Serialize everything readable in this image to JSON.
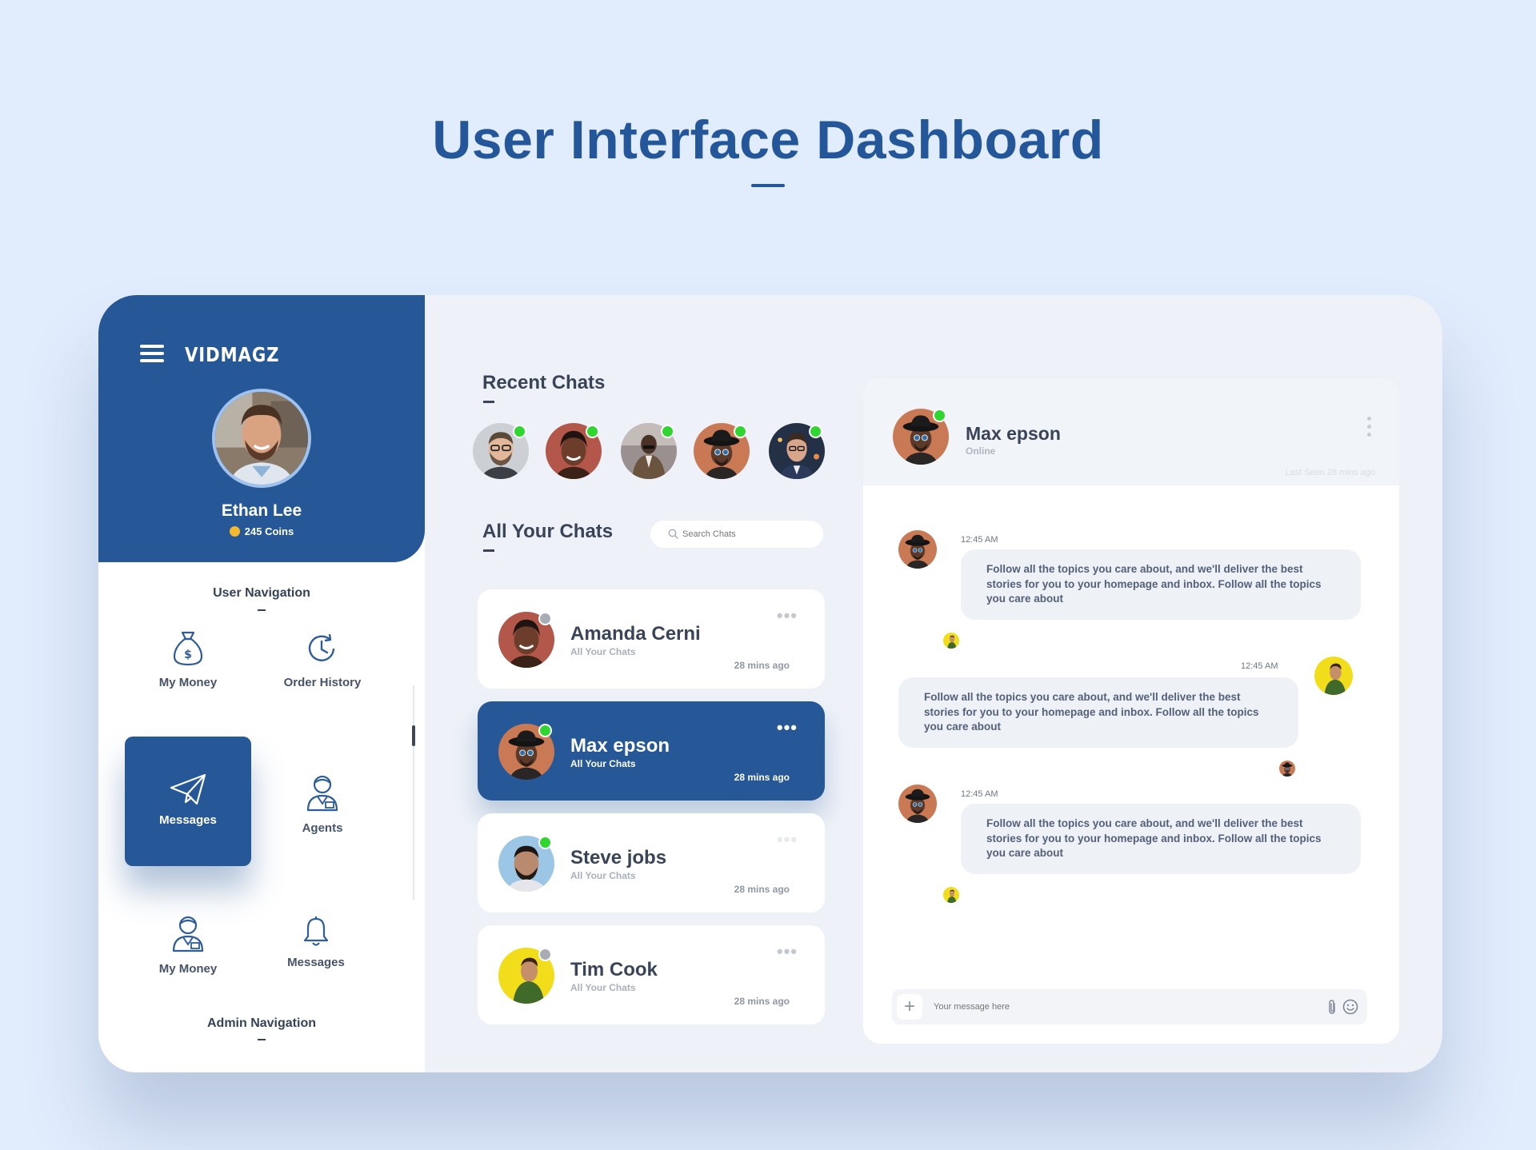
{
  "page": {
    "title": "User Interface Dashboard"
  },
  "colors": {
    "primary": "#265796",
    "online": "#2fd62f",
    "offline": "#a8adb5",
    "coin": "#f5b82e",
    "background": "#e1ecfd"
  },
  "sidebar": {
    "brand": "VIDMAGZ",
    "user": {
      "name": "Ethan Lee",
      "coins": "245 Coins"
    },
    "user_nav_heading": "User Navigation",
    "admin_nav_heading": "Admin Navigation",
    "items": [
      {
        "label": "My Money",
        "icon": "money-bag-icon"
      },
      {
        "label": "Order History",
        "icon": "history-icon"
      },
      {
        "label": "Messages",
        "icon": "paper-plane-icon",
        "active": true
      },
      {
        "label": "Agents",
        "icon": "agent-icon"
      },
      {
        "label": "My Money",
        "icon": "agent-icon"
      },
      {
        "label": "Messages",
        "icon": "bell-icon"
      }
    ]
  },
  "recent": {
    "title": "Recent Chats"
  },
  "chats": {
    "title": "All Your Chats",
    "search_placeholder": "Search Chats",
    "list": [
      {
        "name": "Amanda Cerni",
        "subtitle": "All Your Chats",
        "time": "28 mins ago",
        "status": "offline"
      },
      {
        "name": "Max epson",
        "subtitle": "All Your Chats",
        "time": "28 mins ago",
        "status": "online",
        "active": true
      },
      {
        "name": "Steve jobs",
        "subtitle": "All Your Chats",
        "time": "28 mins ago",
        "status": "online"
      },
      {
        "name": "Tim Cook",
        "subtitle": "All Your Chats",
        "time": "28 mins ago",
        "status": "offline"
      }
    ]
  },
  "conversation": {
    "name": "Max epson",
    "status": "Online",
    "last_seen": "Last Seen 28 mins ago",
    "messages": [
      {
        "time": "12:45 AM",
        "text": "Follow all the topics you care about, and we'll deliver the best stories for you to your homepage and inbox. Follow all the topics you care about",
        "side": "left"
      },
      {
        "time": "12:45 AM",
        "text": "Follow all the topics you care about, and we'll deliver the best stories for you to your homepage and inbox. Follow all the topics you care about",
        "side": "right"
      },
      {
        "time": "12:45 AM",
        "text": "Follow all the topics you care about, and we'll deliver the best stories for you to your homepage and inbox. Follow all the topics you care about",
        "side": "left"
      }
    ],
    "composer_placeholder": "Your message here"
  }
}
